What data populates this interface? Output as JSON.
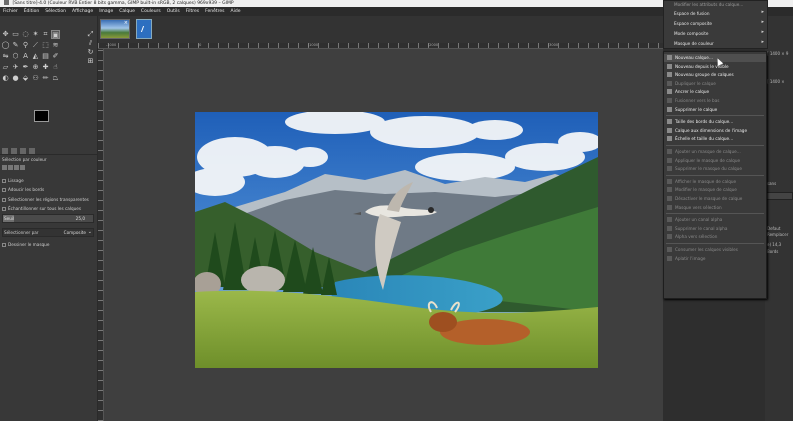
{
  "window": {
    "title": "[Sans titre]-4.0 (Couleur RVB Entier 8 bits gamma, GIMP built-in sRGB, 2 calques) 969x939 – GIMP"
  },
  "menubar": {
    "items": [
      "Fichier",
      "Édition",
      "Sélection",
      "Affichage",
      "Image",
      "Calque",
      "Couleurs",
      "Outils",
      "Filtres",
      "Fenêtres",
      "Aide"
    ]
  },
  "toolbox": {
    "options_title": "Sélection par couleur",
    "mode_label": "Mode",
    "antialias_label": "Lissage",
    "feather_label": "Adoucir les bords",
    "transparent_label": "Sélectionner les régions transparentes",
    "sample_merged_label": "Échantillonner sur tous les calques",
    "threshold_label": "Seuil",
    "threshold_value": "25,0",
    "threshold_fraction": 0.12,
    "criterion_label": "Sélectionner par",
    "criterion_value": "Composite",
    "draw_mask_label": "Dessiner le masque"
  },
  "menu_top": {
    "items": [
      {
        "label": "Modifier les attributs du calque…",
        "dim": true
      },
      {
        "label": "Espace de fusion",
        "submenu": true
      },
      {
        "label": "Espace composite",
        "submenu": true
      },
      {
        "label": "Mode composite",
        "submenu": true
      },
      {
        "label": "Masque de couleur",
        "submenu": true
      }
    ]
  },
  "menu_calque": {
    "items": [
      {
        "label": "Nouveau calque…",
        "highlight": true
      },
      {
        "label": "Nouveau depuis le visible"
      },
      {
        "label": "Nouveau groupe de calques"
      },
      {
        "label": "Dupliquer le calque",
        "dim": true
      },
      {
        "label": "Ancrer le calque"
      },
      {
        "label": "Fusionner vers le bas",
        "dim": true
      },
      {
        "label": "Supprimer le calque"
      },
      {
        "sep": true
      },
      {
        "label": "Taille des bords du calque…"
      },
      {
        "label": "Calque aux dimensions de l'image"
      },
      {
        "label": "Échelle et taille du calque…"
      },
      {
        "sep": true
      },
      {
        "label": "Ajouter un masque de calque…",
        "dim": true
      },
      {
        "label": "Appliquer le masque de calque",
        "dim": true
      },
      {
        "label": "Supprimer le masque du calque",
        "dim": true
      },
      {
        "sep": true
      },
      {
        "label": "Afficher le masque de calque",
        "dim": true
      },
      {
        "label": "Modifier le masque de calque",
        "dim": true
      },
      {
        "label": "Désactiver le masque de calque",
        "dim": true
      },
      {
        "label": "Masque vers sélection",
        "dim": true
      },
      {
        "sep": true
      },
      {
        "label": "Ajouter un canal alpha",
        "dim": true
      },
      {
        "label": "Supprimer le canal alpha",
        "dim": true
      },
      {
        "label": "Alpha vers sélection",
        "dim": true
      },
      {
        "sep": true
      },
      {
        "label": "Consumer les calques visibles",
        "dim": true
      },
      {
        "label": "Aplatir l'image",
        "dim": true
      }
    ]
  },
  "right_dock": {
    "size_text": "[ 1400 × 9",
    "size_text_2": "[ 1400 × ",
    "mode_text": "sans",
    "label_a": "Defaut",
    "label_b": "Remplacer",
    "label_c": "e) 14,3",
    "label_d": "Bords"
  },
  "rulers": {
    "h_ticks": [
      "-1000",
      "|0",
      "|1000",
      "|2000",
      "|3000"
    ]
  },
  "colors": {
    "bg": "#3c3c3c",
    "menu_bg": "#3a3a3a",
    "sky": "#2f6fc2",
    "grass": "#8aa83c"
  },
  "canvas": {
    "photo_alt": ""
  }
}
